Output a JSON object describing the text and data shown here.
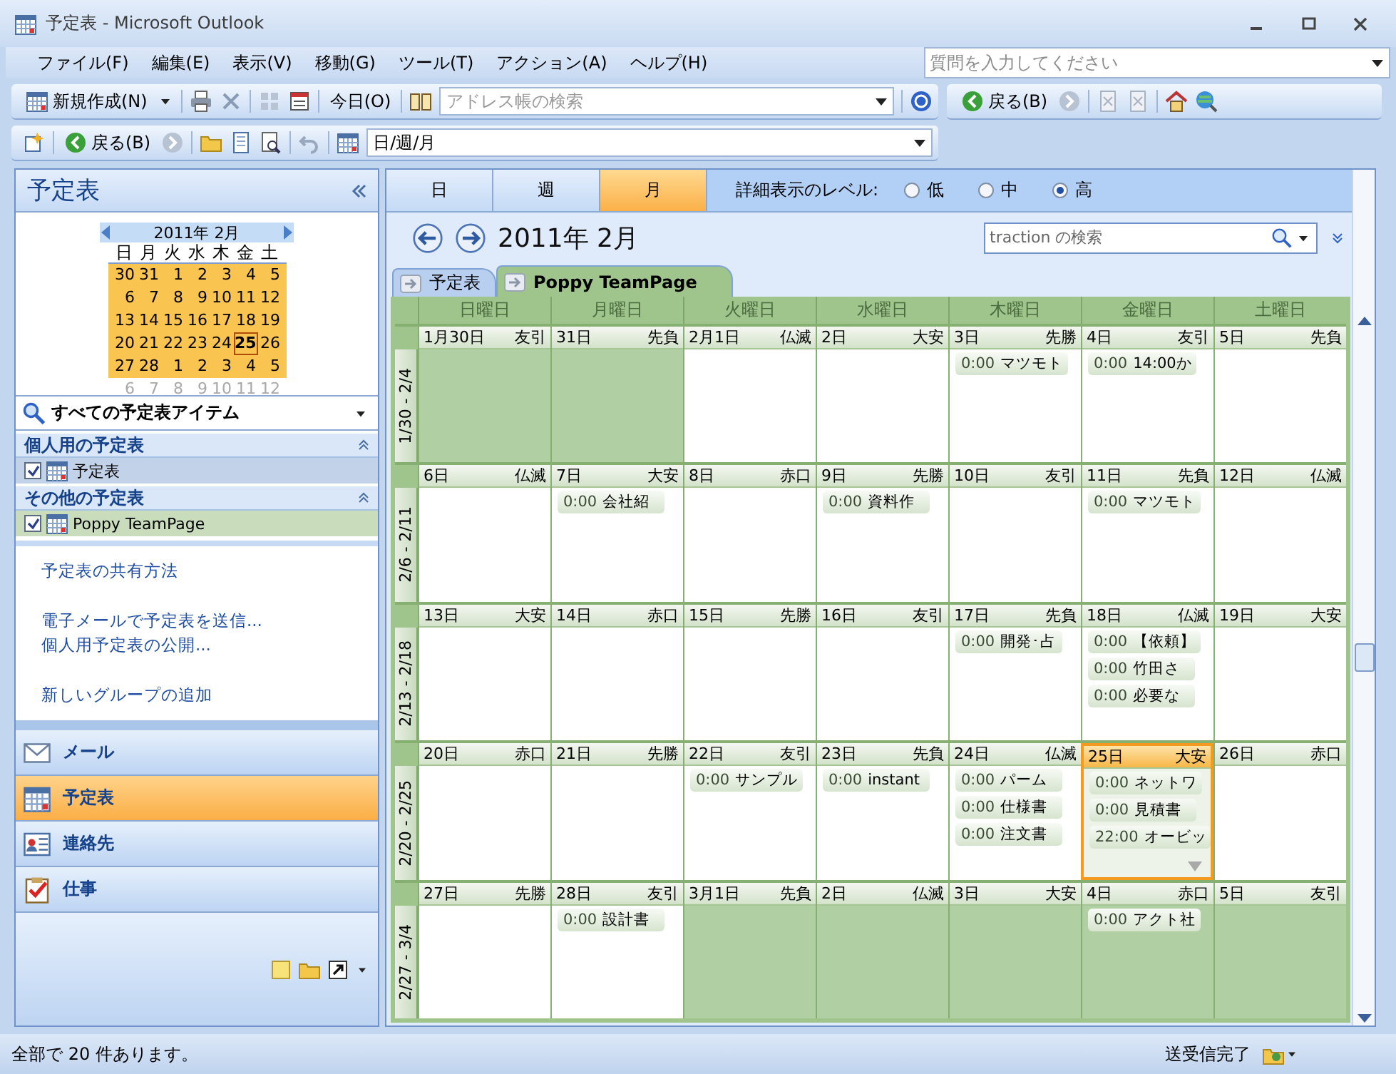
{
  "window": {
    "title": "予定表 - Microsoft Outlook"
  },
  "menu": [
    "ファイル(F)",
    "編集(E)",
    "表示(V)",
    "移動(G)",
    "ツール(T)",
    "アクション(A)",
    "ヘルプ(H)"
  ],
  "help_search": {
    "placeholder": "質問を入力してください"
  },
  "toolbar": {
    "new_button": "新規作成(N)",
    "today_button": "今日(O)",
    "address_search": {
      "placeholder": "アドレス帳の検索"
    },
    "back_button": "戻る(B)"
  },
  "toolbar2": {
    "back_button": "戻る(B)",
    "view_combo": "日/週/月"
  },
  "sidebar": {
    "title": "予定表",
    "mini_calendar": {
      "title": "2011年 2月",
      "weekdays": [
        "日",
        "月",
        "火",
        "水",
        "木",
        "金",
        "土"
      ],
      "weeks": [
        {
          "in_view": true,
          "days": [
            {
              "n": "30",
              "today": false
            },
            {
              "n": "31",
              "today": false
            },
            {
              "n": "1",
              "today": false
            },
            {
              "n": "2",
              "today": false
            },
            {
              "n": "3",
              "today": false
            },
            {
              "n": "4",
              "today": false
            },
            {
              "n": "5",
              "today": false
            }
          ]
        },
        {
          "in_view": true,
          "days": [
            {
              "n": "6",
              "today": false
            },
            {
              "n": "7",
              "today": false
            },
            {
              "n": "8",
              "today": false
            },
            {
              "n": "9",
              "today": false
            },
            {
              "n": "10",
              "today": false
            },
            {
              "n": "11",
              "today": false
            },
            {
              "n": "12",
              "today": false
            }
          ]
        },
        {
          "in_view": true,
          "days": [
            {
              "n": "13",
              "today": false
            },
            {
              "n": "14",
              "today": false
            },
            {
              "n": "15",
              "today": false
            },
            {
              "n": "16",
              "today": false
            },
            {
              "n": "17",
              "today": false
            },
            {
              "n": "18",
              "today": false
            },
            {
              "n": "19",
              "today": false
            }
          ]
        },
        {
          "in_view": true,
          "days": [
            {
              "n": "20",
              "today": false
            },
            {
              "n": "21",
              "today": false
            },
            {
              "n": "22",
              "today": false
            },
            {
              "n": "23",
              "today": false
            },
            {
              "n": "24",
              "today": false
            },
            {
              "n": "25",
              "today": true
            },
            {
              "n": "26",
              "today": false
            }
          ]
        },
        {
          "in_view": true,
          "days": [
            {
              "n": "27",
              "today": false
            },
            {
              "n": "28",
              "today": false
            },
            {
              "n": "1",
              "today": false
            },
            {
              "n": "2",
              "today": false
            },
            {
              "n": "3",
              "today": false
            },
            {
              "n": "4",
              "today": false
            },
            {
              "n": "5",
              "today": false
            }
          ]
        },
        {
          "in_view": false,
          "days": [
            {
              "n": "6",
              "today": false
            },
            {
              "n": "7",
              "today": false
            },
            {
              "n": "8",
              "today": false
            },
            {
              "n": "9",
              "today": false
            },
            {
              "n": "10",
              "today": false
            },
            {
              "n": "11",
              "today": false
            },
            {
              "n": "12",
              "today": false
            }
          ]
        }
      ]
    },
    "filter": "すべての予定表アイテム",
    "groups": [
      {
        "title": "個人用の予定表",
        "expanded": true,
        "items": [
          {
            "label": "予定表",
            "checked": true,
            "color": "#c2d2e9"
          }
        ]
      },
      {
        "title": "その他の予定表",
        "expanded": true,
        "items": [
          {
            "label": "Poppy TeamPage",
            "checked": true,
            "color": "#c9ddbd"
          }
        ]
      }
    ],
    "link_groups": [
      [
        "予定表の共有方法"
      ],
      [
        "電子メールで予定表を送信...",
        "個人用予定表の公開..."
      ],
      [
        "新しいグループの追加"
      ]
    ],
    "nav": [
      {
        "label": "メール",
        "kind": "mail",
        "selected": false
      },
      {
        "label": "予定表",
        "kind": "calendar",
        "selected": true
      },
      {
        "label": "連絡先",
        "kind": "contacts",
        "selected": false
      },
      {
        "label": "仕事",
        "kind": "tasks",
        "selected": false
      }
    ]
  },
  "view_tabs": [
    {
      "label": "日",
      "selected": false
    },
    {
      "label": "週",
      "selected": false
    },
    {
      "label": "月",
      "selected": true
    }
  ],
  "detail_level": {
    "label": "詳細表示のレベル:",
    "options": [
      {
        "label": "低",
        "selected": false
      },
      {
        "label": "中",
        "selected": false
      },
      {
        "label": "高",
        "selected": true
      }
    ]
  },
  "calendar_title": "2011年 2月",
  "search": {
    "placeholder": "traction の検索"
  },
  "calendar_tabs": [
    {
      "label": "予定表",
      "selected": false
    },
    {
      "label": "Poppy TeamPage",
      "selected": true
    }
  ],
  "weekday_headers": [
    "日曜日",
    "月曜日",
    "火曜日",
    "水曜日",
    "木曜日",
    "金曜日",
    "土曜日"
  ],
  "weeks": [
    {
      "label": "1/30 - 2/4",
      "days": [
        {
          "date": "1月30日",
          "rokuyo": "友引",
          "other_month": true,
          "selected": false,
          "overflow": false
        },
        {
          "date": "31日",
          "rokuyo": "先負",
          "other_month": true,
          "selected": false,
          "overflow": false
        },
        {
          "date": "2月1日",
          "rokuyo": "仏滅",
          "other_month": false,
          "selected": false,
          "overflow": false
        },
        {
          "date": "2日",
          "rokuyo": "大安",
          "other_month": false,
          "selected": false,
          "overflow": false
        },
        {
          "date": "3日",
          "rokuyo": "先勝",
          "other_month": false,
          "selected": false,
          "overflow": false,
          "events": [
            {
              "time": "0:00",
              "title": "マツモト"
            }
          ]
        },
        {
          "date": "4日",
          "rokuyo": "友引",
          "other_month": false,
          "selected": false,
          "overflow": false,
          "events": [
            {
              "time": "0:00",
              "title": "14:00か"
            }
          ]
        },
        {
          "date": "5日",
          "rokuyo": "先負",
          "other_month": false,
          "selected": false,
          "overflow": false
        }
      ]
    },
    {
      "label": "2/6 - 2/11",
      "days": [
        {
          "date": "6日",
          "rokuyo": "仏滅",
          "other_month": false,
          "selected": false,
          "overflow": false
        },
        {
          "date": "7日",
          "rokuyo": "大安",
          "other_month": false,
          "selected": false,
          "overflow": false,
          "events": [
            {
              "time": "0:00",
              "title": "会社紹"
            }
          ]
        },
        {
          "date": "8日",
          "rokuyo": "赤口",
          "other_month": false,
          "selected": false,
          "overflow": false
        },
        {
          "date": "9日",
          "rokuyo": "先勝",
          "other_month": false,
          "selected": false,
          "overflow": false,
          "events": [
            {
              "time": "0:00",
              "title": "資料作"
            }
          ]
        },
        {
          "date": "10日",
          "rokuyo": "友引",
          "other_month": false,
          "selected": false,
          "overflow": false
        },
        {
          "date": "11日",
          "rokuyo": "先負",
          "other_month": false,
          "selected": false,
          "overflow": false,
          "events": [
            {
              "time": "0:00",
              "title": "マツモト"
            }
          ]
        },
        {
          "date": "12日",
          "rokuyo": "仏滅",
          "other_month": false,
          "selected": false,
          "overflow": false
        }
      ]
    },
    {
      "label": "2/13 - 2/18",
      "days": [
        {
          "date": "13日",
          "rokuyo": "大安",
          "other_month": false,
          "selected": false,
          "overflow": false
        },
        {
          "date": "14日",
          "rokuyo": "赤口",
          "other_month": false,
          "selected": false,
          "overflow": false
        },
        {
          "date": "15日",
          "rokuyo": "先勝",
          "other_month": false,
          "selected": false,
          "overflow": false
        },
        {
          "date": "16日",
          "rokuyo": "友引",
          "other_month": false,
          "selected": false,
          "overflow": false
        },
        {
          "date": "17日",
          "rokuyo": "先負",
          "other_month": false,
          "selected": false,
          "overflow": false,
          "events": [
            {
              "time": "0:00",
              "title": "開発･占"
            }
          ]
        },
        {
          "date": "18日",
          "rokuyo": "仏滅",
          "other_month": false,
          "selected": false,
          "overflow": false,
          "events": [
            {
              "time": "0:00",
              "title": "【依頼】"
            },
            {
              "time": "0:00",
              "title": "竹田さ"
            },
            {
              "time": "0:00",
              "title": "必要な"
            }
          ]
        },
        {
          "date": "19日",
          "rokuyo": "大安",
          "other_month": false,
          "selected": false,
          "overflow": false
        }
      ]
    },
    {
      "label": "2/20 - 2/25",
      "days": [
        {
          "date": "20日",
          "rokuyo": "赤口",
          "other_month": false,
          "selected": false,
          "overflow": false
        },
        {
          "date": "21日",
          "rokuyo": "先勝",
          "other_month": false,
          "selected": false,
          "overflow": false
        },
        {
          "date": "22日",
          "rokuyo": "友引",
          "other_month": false,
          "selected": false,
          "overflow": false,
          "events": [
            {
              "time": "0:00",
              "title": "サンプル"
            }
          ]
        },
        {
          "date": "23日",
          "rokuyo": "先負",
          "other_month": false,
          "selected": false,
          "overflow": false,
          "events": [
            {
              "time": "0:00",
              "title": "instant"
            }
          ]
        },
        {
          "date": "24日",
          "rokuyo": "仏滅",
          "other_month": false,
          "selected": false,
          "overflow": false,
          "events": [
            {
              "time": "0:00",
              "title": "パーム"
            },
            {
              "time": "0:00",
              "title": "仕様書"
            },
            {
              "time": "0:00",
              "title": "注文書"
            }
          ]
        },
        {
          "date": "25日",
          "rokuyo": "大安",
          "other_month": false,
          "selected": true,
          "overflow": true,
          "events": [
            {
              "time": "0:00",
              "title": "ネットワ"
            },
            {
              "time": "0:00",
              "title": "見積書"
            },
            {
              "time": "22:00",
              "title": "オービッ"
            }
          ]
        },
        {
          "date": "26日",
          "rokuyo": "赤口",
          "other_month": false,
          "selected": false,
          "overflow": false
        }
      ]
    },
    {
      "label": "2/27 - 3/4",
      "days": [
        {
          "date": "27日",
          "rokuyo": "先勝",
          "other_month": false,
          "selected": false,
          "overflow": false
        },
        {
          "date": "28日",
          "rokuyo": "友引",
          "other_month": false,
          "selected": false,
          "overflow": false,
          "events": [
            {
              "time": "0:00",
              "title": "設計書"
            }
          ]
        },
        {
          "date": "3月1日",
          "rokuyo": "先負",
          "other_month": true,
          "selected": false,
          "overflow": false
        },
        {
          "date": "2日",
          "rokuyo": "仏滅",
          "other_month": true,
          "selected": false,
          "overflow": false
        },
        {
          "date": "3日",
          "rokuyo": "大安",
          "other_month": true,
          "selected": false,
          "overflow": false
        },
        {
          "date": "4日",
          "rokuyo": "赤口",
          "other_month": true,
          "selected": false,
          "overflow": false,
          "events": [
            {
              "time": "0:00",
              "title": "アクト社"
            }
          ]
        },
        {
          "date": "5日",
          "rokuyo": "友引",
          "other_month": true,
          "selected": false,
          "overflow": false
        }
      ]
    }
  ],
  "status_bar": {
    "count": "全部で 20 件あります。",
    "sync": "送受信完了"
  }
}
